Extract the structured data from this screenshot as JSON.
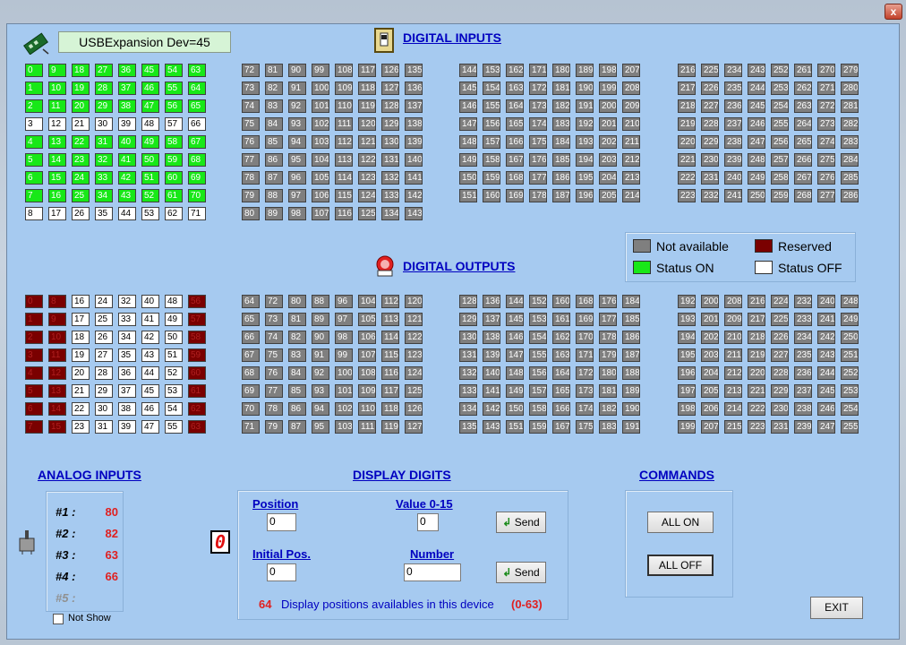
{
  "window": {
    "close_label": "x"
  },
  "device": {
    "name": "USBExpansion Dev=45"
  },
  "sections": {
    "digital_inputs": "DIGITAL INPUTS",
    "digital_outputs": "DIGITAL OUTPUTS",
    "analog_inputs": "ANALOG INPUTS",
    "display_digits": "DISPLAY DIGITS",
    "commands": "COMMANDS"
  },
  "legend": {
    "not_available": "Not available",
    "reserved": "Reserved",
    "status_on": "Status ON",
    "status_off": "Status OFF"
  },
  "colors": {
    "on": "#18e818",
    "off": "#ffffff",
    "reserved": "#7a0000",
    "na": "#7f7f7f"
  },
  "digital_inputs": {
    "rows": 8,
    "first_block_states": [
      [
        "on",
        "on",
        "on",
        "on",
        "on",
        "on",
        "on",
        "on"
      ],
      [
        "on",
        "on",
        "on",
        "on",
        "on",
        "on",
        "on",
        "on"
      ],
      [
        "on",
        "on",
        "on",
        "on",
        "on",
        "on",
        "on",
        "on"
      ],
      [
        "off",
        "off",
        "off",
        "off",
        "off",
        "off",
        "off",
        "off"
      ],
      [
        "on",
        "on",
        "on",
        "on",
        "on",
        "on",
        "on",
        "on"
      ],
      [
        "on",
        "on",
        "on",
        "on",
        "on",
        "on",
        "on",
        "on"
      ],
      [
        "on",
        "on",
        "on",
        "on",
        "on",
        "on",
        "on",
        "on"
      ],
      [
        "on",
        "on",
        "on",
        "on",
        "on",
        "on",
        "on",
        "on"
      ],
      [
        "off",
        "off",
        "off",
        "off",
        "off",
        "off",
        "off",
        "off"
      ]
    ],
    "blocks": [
      {
        "start": 0,
        "cols": 8,
        "rows": 9,
        "step": 9
      },
      {
        "start": 72,
        "cols": 8,
        "rows": 9,
        "step": 9
      },
      {
        "start": 144,
        "cols": 8,
        "rows": 8,
        "step": 9
      },
      {
        "start": 216,
        "cols": 8,
        "rows": 8,
        "step": 9
      }
    ]
  },
  "digital_outputs": {
    "blocks": [
      {
        "start": 0,
        "cols": 8,
        "rows": 8,
        "step": 8
      },
      {
        "start": 64,
        "cols": 8,
        "rows": 8,
        "step": 8
      },
      {
        "start": 128,
        "cols": 8,
        "rows": 8,
        "step": 8
      },
      {
        "start": 192,
        "cols": 8,
        "rows": 8,
        "step": 8
      }
    ],
    "reserved_cols_block0": [
      0,
      1,
      7
    ]
  },
  "analog_inputs": {
    "items": [
      {
        "name": "#1 :",
        "value": "80"
      },
      {
        "name": "#2 :",
        "value": "82"
      },
      {
        "name": "#3 :",
        "value": "63"
      },
      {
        "name": "#4 :",
        "value": "66"
      },
      {
        "name": "#5 :",
        "value": ""
      }
    ],
    "not_show_label": "Not Show"
  },
  "display": {
    "digit": "0",
    "position_label": "Position",
    "position_value": "0",
    "value_label": "Value 0-15",
    "value_value": "0",
    "initial_label": "Initial Pos.",
    "initial_value": "0",
    "number_label": "Number",
    "number_value": "0",
    "send_label": "Send",
    "count": "64",
    "count_text": "Display positions availables in this device",
    "range": "(0-63)"
  },
  "commands": {
    "all_on": "ALL ON",
    "all_off": "ALL OFF"
  },
  "exit_label": "EXIT"
}
